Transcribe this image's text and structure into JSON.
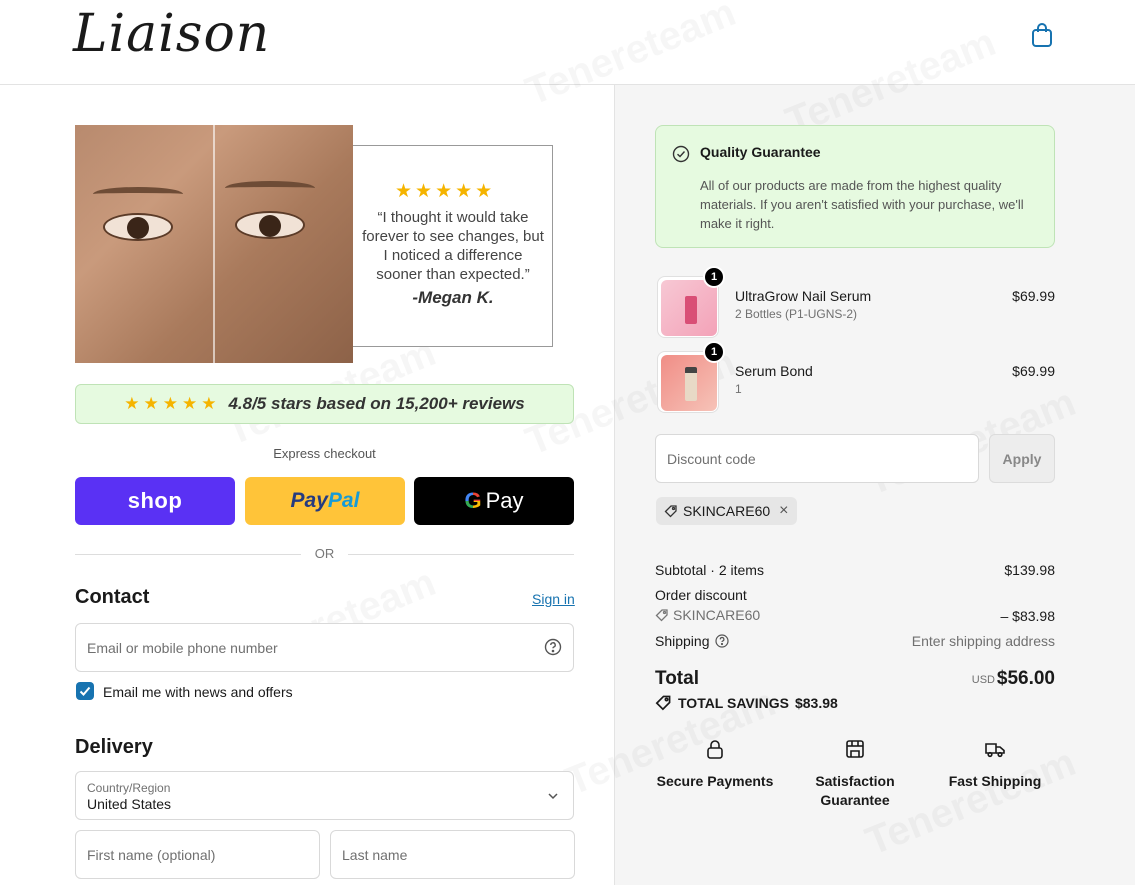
{
  "header": {
    "logo": "Liaison",
    "bag_icon": "shopping-bag-icon"
  },
  "hero": {
    "stars": "★★★★★",
    "quote": "“I thought it would take forever to see changes, but I noticed a difference sooner than expected.”",
    "author": "-Megan K."
  },
  "rating": {
    "stars": "★★★★★",
    "text": "4.8/5 stars based on 15,200+ reviews"
  },
  "express": {
    "label": "Express checkout",
    "shop_label": "shop",
    "paypal_label_1": "Pay",
    "paypal_label_2": "Pal",
    "gpay_g": "G",
    "gpay_label": "Pay",
    "or_label": "OR"
  },
  "contact": {
    "title": "Contact",
    "sign_in": "Sign in",
    "email_placeholder": "Email or mobile phone number",
    "newsletter_label": "Email me with news and offers",
    "newsletter_checked": true
  },
  "delivery": {
    "title": "Delivery",
    "country_label": "Country/Region",
    "country_value": "United States",
    "first_name_placeholder": "First name (optional)",
    "last_name_placeholder": "Last name"
  },
  "guarantee": {
    "title": "Quality Guarantee",
    "body": "All of our products are made from the highest quality materials. If you aren't satisfied with your purchase, we'll make it right."
  },
  "cart": {
    "items": [
      {
        "name": "UltraGrow Nail Serum",
        "variant": "2 Bottles (P1-UGNS-2)",
        "price": "$69.99",
        "qty": "1"
      },
      {
        "name": "Serum Bond",
        "variant": "1",
        "price": "$69.99",
        "qty": "1"
      }
    ]
  },
  "discount": {
    "placeholder": "Discount code",
    "apply_label": "Apply",
    "applied_code": "SKINCARE60",
    "remove_icon": "×"
  },
  "summary": {
    "subtotal_label": "Subtotal · 2 items",
    "subtotal_value": "$139.98",
    "order_discount_label": "Order discount",
    "discount_code": "SKINCARE60",
    "discount_value": "– $83.98",
    "shipping_label": "Shipping",
    "shipping_value": "Enter shipping address",
    "total_label": "Total",
    "currency": "USD",
    "total_value": "$56.00",
    "savings_label": "TOTAL SAVINGS",
    "savings_value": "$83.98"
  },
  "features": [
    {
      "icon": "lock-icon",
      "label": "Secure Payments"
    },
    {
      "icon": "store-icon",
      "label": "Satisfaction Guarantee"
    },
    {
      "icon": "delivery-truck-icon",
      "label": "Fast Shipping"
    }
  ],
  "colors": {
    "accent_link": "#1773b0",
    "shop_pay": "#5a31f4",
    "paypal": "#ffc439",
    "guarantee_bg": "#e6fae0",
    "star": "#f5b400"
  },
  "watermark": "Tenereteam"
}
